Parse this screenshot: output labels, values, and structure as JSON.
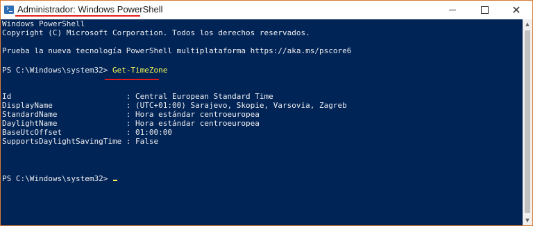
{
  "window": {
    "title": "Administrador: Windows PowerShell",
    "icon": "powershell-icon",
    "controls": {
      "minimize_icon": "minimize-icon",
      "maximize_icon": "maximize-icon",
      "close_glyph": "✕"
    }
  },
  "console": {
    "header_line1": "Windows PowerShell",
    "header_line2": "Copyright (C) Microsoft Corporation. Todos los derechos reservados.",
    "header_line3": "Prueba la nueva tecnología PowerShell multiplataforma https://aka.ms/pscore6",
    "prompt1": "PS C:\\Windows\\system32> ",
    "command": "Get-TimeZone",
    "output": [
      "Id                         : Central European Standard Time",
      "DisplayName                : (UTC+01:00) Sarajevo, Skopie, Varsovia, Zagreb",
      "StandardName               : Hora estándar centroeuropea",
      "DaylightName               : Hora estándar centroeuropea",
      "BaseUtcOffset              : 01:00:00",
      "SupportsDaylightSavingTime : False"
    ],
    "prompt2": "PS C:\\Windows\\system32> "
  },
  "colors": {
    "console_bg": "#012456",
    "console_fg": "#eeedf0",
    "command_fg": "#fdfd54",
    "highlight_underline": "#e11d1d",
    "window_border": "#d97a34"
  },
  "scrollbar": {
    "up_arrow_glyph": "▲",
    "down_arrow_glyph": "▼"
  }
}
